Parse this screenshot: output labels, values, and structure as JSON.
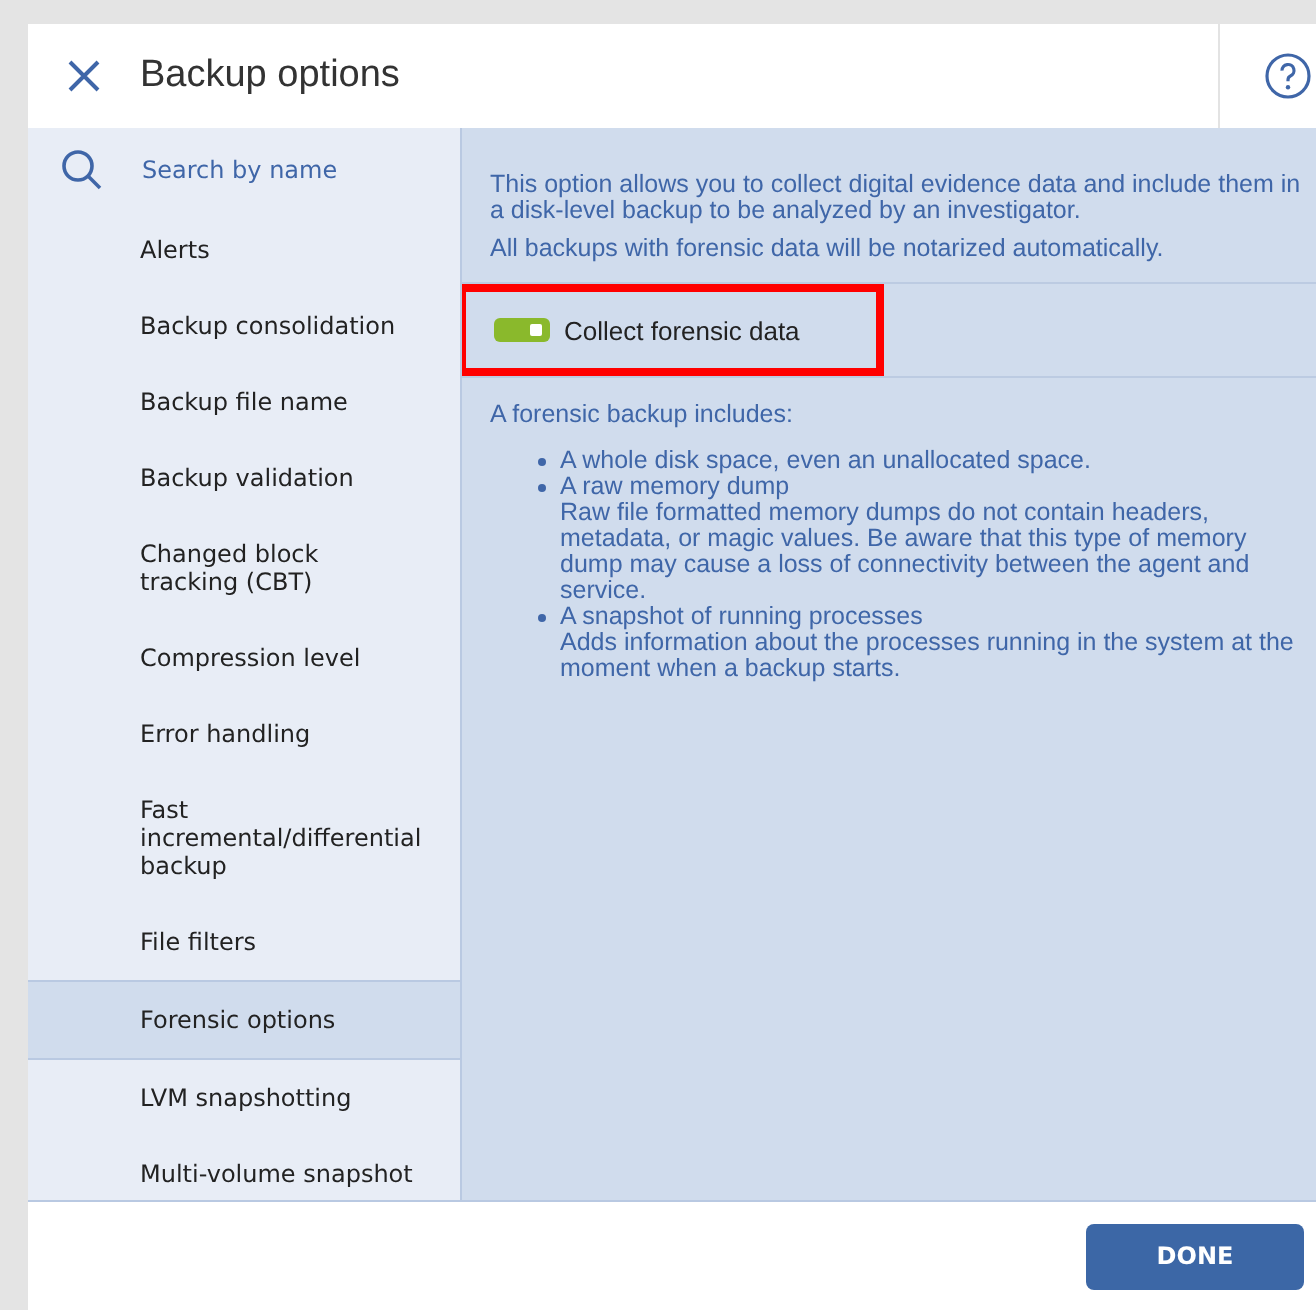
{
  "dialog": {
    "title": "Backup options"
  },
  "search": {
    "placeholder": "Search by name"
  },
  "sidebar": {
    "items": [
      {
        "label": "Alerts",
        "selected": false
      },
      {
        "label": "Backup consolidation",
        "selected": false
      },
      {
        "label": "Backup file name",
        "selected": false
      },
      {
        "label": "Backup validation",
        "selected": false
      },
      {
        "label": "Changed block tracking (CBT)",
        "selected": false
      },
      {
        "label": "Compression level",
        "selected": false
      },
      {
        "label": "Error handling",
        "selected": false
      },
      {
        "label": "Fast incremental/differential backup",
        "selected": false
      },
      {
        "label": "File filters",
        "selected": false
      },
      {
        "label": "Forensic options",
        "selected": true
      },
      {
        "label": "LVM snapshotting",
        "selected": false
      },
      {
        "label": "Multi-volume snapshot",
        "selected": false
      }
    ]
  },
  "content": {
    "description": "This option allows you to collect digital evidence data and include them in a disk-level backup to be analyzed by an investigator.",
    "note": "All backups with forensic data will be notarized automatically.",
    "toggle": {
      "label": "Collect forensic data",
      "on": true,
      "highlighted": true
    },
    "includes_heading": "A forensic backup includes:",
    "includes": [
      {
        "title": "A whole disk space, even an unallocated space."
      },
      {
        "title": "A raw memory dump",
        "detail": "Raw file formatted memory dumps do not contain headers, metadata, or magic values. Be aware that this type of memory dump may cause a loss of connectivity between the agent and service."
      },
      {
        "title": "A snapshot of running processes",
        "detail": "Adds information about the processes running in the system at the moment when a backup starts."
      }
    ]
  },
  "footer": {
    "done_button": "DONE"
  }
}
